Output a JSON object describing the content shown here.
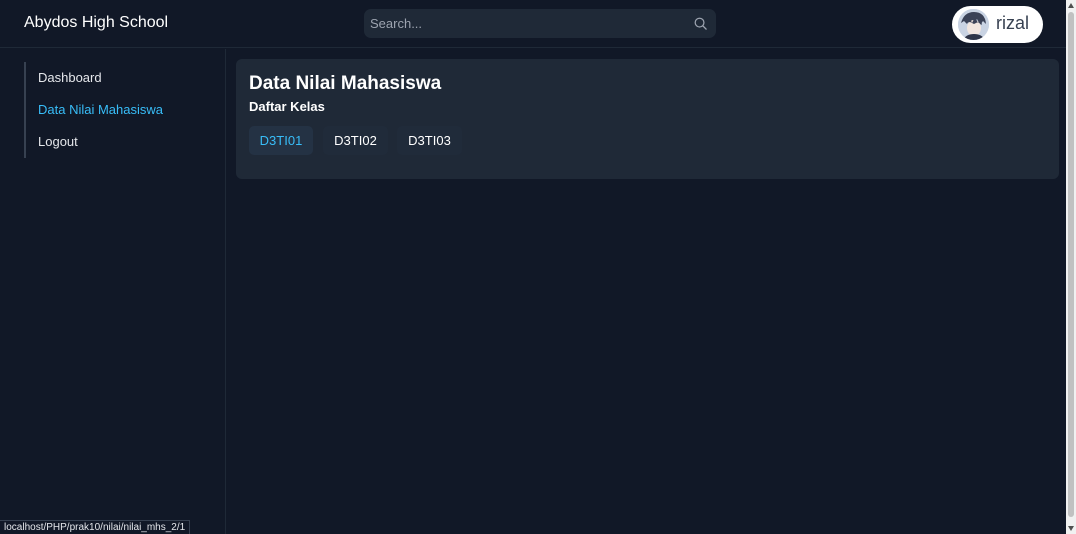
{
  "header": {
    "brand": "Abydos High School",
    "search_placeholder": "Search...",
    "search_icon": "search-icon",
    "user": {
      "name": "rizal",
      "avatar_icon": "avatar"
    }
  },
  "sidebar": {
    "items": [
      {
        "label": "Dashboard",
        "active": false
      },
      {
        "label": "Data Nilai Mahasiswa",
        "active": true
      },
      {
        "label": "Logout",
        "active": false
      }
    ]
  },
  "main": {
    "title": "Data Nilai Mahasiswa",
    "subtitle": "Daftar Kelas",
    "classes": [
      {
        "label": "D3TI01",
        "active": true
      },
      {
        "label": "D3TI02",
        "active": false
      },
      {
        "label": "D3TI03",
        "active": false
      }
    ]
  },
  "status_bar": {
    "url": "localhost/PHP/prak10/nilai/nilai_mhs_2/1"
  },
  "colors": {
    "background": "#111827",
    "card": "#1f2937",
    "accent": "#38bdf8",
    "text": "#e5e7eb"
  }
}
